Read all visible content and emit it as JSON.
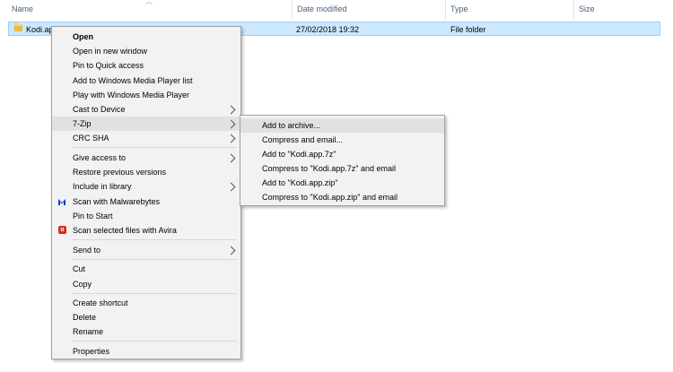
{
  "columns": {
    "name": "Name",
    "date_modified": "Date modified",
    "type": "Type",
    "size": "Size"
  },
  "file_row": {
    "name": "Kodi.ap",
    "date_modified": "27/02/2018 19:32",
    "type": "File folder"
  },
  "context_menu": {
    "open": "Open",
    "open_new_window": "Open in new window",
    "pin_quick_access": "Pin to Quick access",
    "add_wmp_list": "Add to Windows Media Player list",
    "play_wmp": "Play with Windows Media Player",
    "cast_to_device": "Cast to Device",
    "seven_zip": "7-Zip",
    "crc_sha": "CRC SHA",
    "give_access": "Give access to",
    "restore_versions": "Restore previous versions",
    "include_library": "Include in library",
    "scan_malwarebytes": "Scan with Malwarebytes",
    "pin_start": "Pin to Start",
    "scan_avira": "Scan selected files with Avira",
    "send_to": "Send to",
    "cut": "Cut",
    "copy": "Copy",
    "create_shortcut": "Create shortcut",
    "delete": "Delete",
    "rename": "Rename",
    "properties": "Properties"
  },
  "submenu_7zip": {
    "add_archive": "Add to archive...",
    "compress_email": "Compress and email...",
    "add_7z": "Add to \"Kodi.app.7z\"",
    "compress_7z_email": "Compress to \"Kodi.app.7z\" and email",
    "add_zip": "Add to \"Kodi.app.zip\"",
    "compress_zip_email": "Compress to \"Kodi.app.zip\" and email"
  },
  "colors": {
    "selection_bg": "#cce8ff",
    "menu_bg": "#f2f2f2",
    "header_text": "#4c607a",
    "malwarebytes_blue": "#0d3ed6",
    "avira_red": "#d52b1e"
  }
}
